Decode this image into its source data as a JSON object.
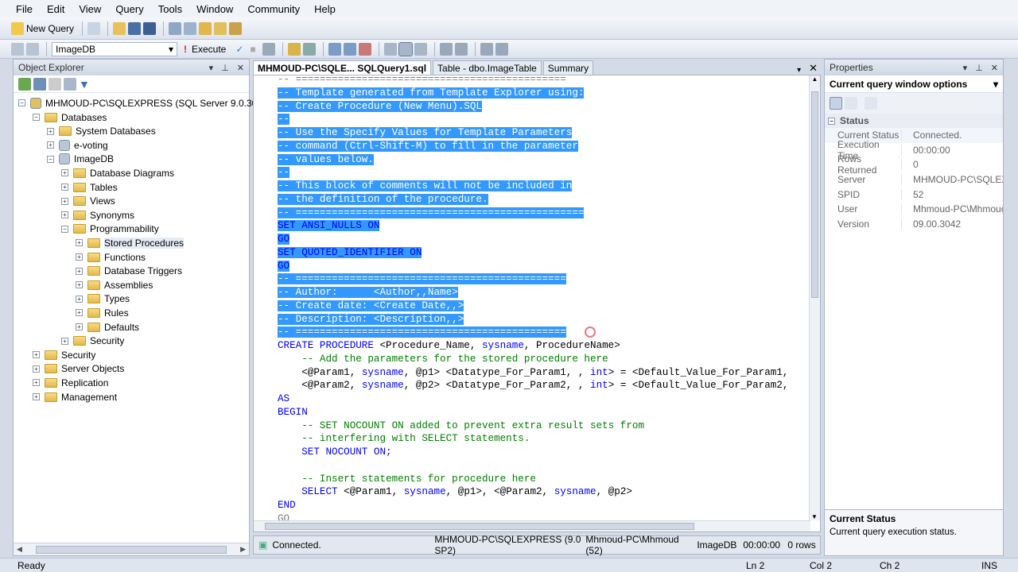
{
  "menu": [
    "File",
    "Edit",
    "View",
    "Query",
    "Tools",
    "Window",
    "Community",
    "Help"
  ],
  "toolbar": {
    "new_query": "New Query",
    "database": "ImageDB",
    "execute": "Execute"
  },
  "object_explorer": {
    "title": "Object Explorer",
    "server": "MHMOUD-PC\\SQLEXPRESS (SQL Server 9.0.3042",
    "tree": [
      {
        "label": "Databases",
        "level": 1,
        "toggle": "−"
      },
      {
        "label": "System Databases",
        "level": 2,
        "toggle": "+"
      },
      {
        "label": "e-voting",
        "level": 2,
        "toggle": "+",
        "db": true
      },
      {
        "label": "ImageDB",
        "level": 2,
        "toggle": "−",
        "db": true
      },
      {
        "label": "Database Diagrams",
        "level": 3,
        "toggle": "+"
      },
      {
        "label": "Tables",
        "level": 3,
        "toggle": "+"
      },
      {
        "label": "Views",
        "level": 3,
        "toggle": "+"
      },
      {
        "label": "Synonyms",
        "level": 3,
        "toggle": "+"
      },
      {
        "label": "Programmability",
        "level": 3,
        "toggle": "−"
      },
      {
        "label": "Stored Procedures",
        "level": 4,
        "toggle": "+"
      },
      {
        "label": "Functions",
        "level": 4,
        "toggle": "+"
      },
      {
        "label": "Database Triggers",
        "level": 4,
        "toggle": "+"
      },
      {
        "label": "Assemblies",
        "level": 4,
        "toggle": "+"
      },
      {
        "label": "Types",
        "level": 4,
        "toggle": "+"
      },
      {
        "label": "Rules",
        "level": 4,
        "toggle": "+"
      },
      {
        "label": "Defaults",
        "level": 4,
        "toggle": "+"
      },
      {
        "label": "Security",
        "level": 3,
        "toggle": "+"
      },
      {
        "label": "Security",
        "level": 1,
        "toggle": "+"
      },
      {
        "label": "Server Objects",
        "level": 1,
        "toggle": "+"
      },
      {
        "label": "Replication",
        "level": 1,
        "toggle": "+"
      },
      {
        "label": "Management",
        "level": 1,
        "toggle": "+"
      }
    ]
  },
  "tabs": [
    "MHMOUD-PC\\SQLE... SQLQuery1.sql",
    "Table - dbo.ImageTable",
    "Summary"
  ],
  "code_lines": [
    {
      "t": "-- =============================================",
      "c": "gray",
      "sel": false
    },
    {
      "t": "-- Template generated from Template Explorer using:",
      "c": "cm",
      "sel": true
    },
    {
      "t": "-- Create Procedure (New Menu).SQL",
      "c": "cm",
      "sel": true
    },
    {
      "t": "--",
      "c": "cm",
      "sel": true
    },
    {
      "t": "-- Use the Specify Values for Template Parameters",
      "c": "cm",
      "sel": true
    },
    {
      "t": "-- command (Ctrl-Shift-M) to fill in the parameter",
      "c": "cm",
      "sel": true
    },
    {
      "t": "-- values below.",
      "c": "cm",
      "sel": true
    },
    {
      "t": "--",
      "c": "cm",
      "sel": true
    },
    {
      "t": "-- This block of comments will not be included in",
      "c": "cm",
      "sel": true
    },
    {
      "t": "-- the definition of the procedure.",
      "c": "cm",
      "sel": true
    },
    {
      "t": "-- ================================================",
      "c": "cm",
      "sel": true
    },
    {
      "t": "SET ANSI_NULLS ON",
      "c": "kw",
      "sel": true
    },
    {
      "t": "GO",
      "c": "kw",
      "sel": true
    },
    {
      "t": "SET QUOTED_IDENTIFIER ON",
      "c": "kw",
      "sel": true
    },
    {
      "t": "GO",
      "c": "kw",
      "sel": true
    },
    {
      "t": "-- =============================================",
      "c": "cm",
      "sel": true
    },
    {
      "t": "-- Author:      <Author,,Name>",
      "c": "cm",
      "sel": true
    },
    {
      "t": "-- Create date: <Create Date,,>",
      "c": "cm",
      "sel": true
    },
    {
      "t": "-- Description: <Description,,>",
      "c": "cm",
      "sel": true
    },
    {
      "t": "-- =============================================",
      "c": "cm",
      "sel": true
    },
    {
      "t": "CREATE PROCEDURE <Procedure_Name, sysname, ProcedureName>",
      "c": "mix1",
      "sel": false
    },
    {
      "t": "    -- Add the parameters for the stored procedure here",
      "c": "cm",
      "sel": false
    },
    {
      "t": "    <@Param1, sysname, @p1> <Datatype_For_Param1, , int> = <Default_Value_For_Param1,",
      "c": "mix2",
      "sel": false
    },
    {
      "t": "    <@Param2, sysname, @p2> <Datatype_For_Param2, , int> = <Default_Value_For_Param2,",
      "c": "mix2",
      "sel": false
    },
    {
      "t": "AS",
      "c": "kw",
      "sel": false
    },
    {
      "t": "BEGIN",
      "c": "kw",
      "sel": false
    },
    {
      "t": "    -- SET NOCOUNT ON added to prevent extra result sets from",
      "c": "cm",
      "sel": false
    },
    {
      "t": "    -- interfering with SELECT statements.",
      "c": "cm",
      "sel": false
    },
    {
      "t": "    SET NOCOUNT ON;",
      "c": "kw",
      "sel": false
    },
    {
      "t": "",
      "c": "cm",
      "sel": false
    },
    {
      "t": "    -- Insert statements for procedure here",
      "c": "cm",
      "sel": false
    },
    {
      "t": "    SELECT <@Param1, sysname, @p1>, <@Param2, sysname, @p2>",
      "c": "mix3",
      "sel": false
    },
    {
      "t": "END",
      "c": "kw",
      "sel": false
    },
    {
      "t": "GO",
      "c": "gray",
      "sel": false
    }
  ],
  "editor_status": {
    "connected": "Connected.",
    "server": "MHMOUD-PC\\SQLEXPRESS (9.0 SP2)",
    "user": "Mhmoud-PC\\Mhmoud (52)",
    "db": "ImageDB",
    "time": "00:00:00",
    "rows": "0 rows"
  },
  "properties": {
    "title": "Properties",
    "selector": "Current query window options",
    "section": "Status",
    "rows": [
      {
        "k": "Current Status",
        "v": "Connected."
      },
      {
        "k": "Execution Time",
        "v": "00:00:00"
      },
      {
        "k": "Rows Returned",
        "v": "0"
      },
      {
        "k": "Server",
        "v": "MHMOUD-PC\\SQLEXPRESS"
      },
      {
        "k": "SPID",
        "v": "52"
      },
      {
        "k": "User",
        "v": "Mhmoud-PC\\Mhmoud"
      },
      {
        "k": "Version",
        "v": "09.00.3042"
      }
    ],
    "desc_title": "Current Status",
    "desc_text": "Current query execution status."
  },
  "statusbar": {
    "ready": "Ready",
    "ln": "Ln 2",
    "col": "Col 2",
    "ch": "Ch 2",
    "ins": "INS"
  }
}
